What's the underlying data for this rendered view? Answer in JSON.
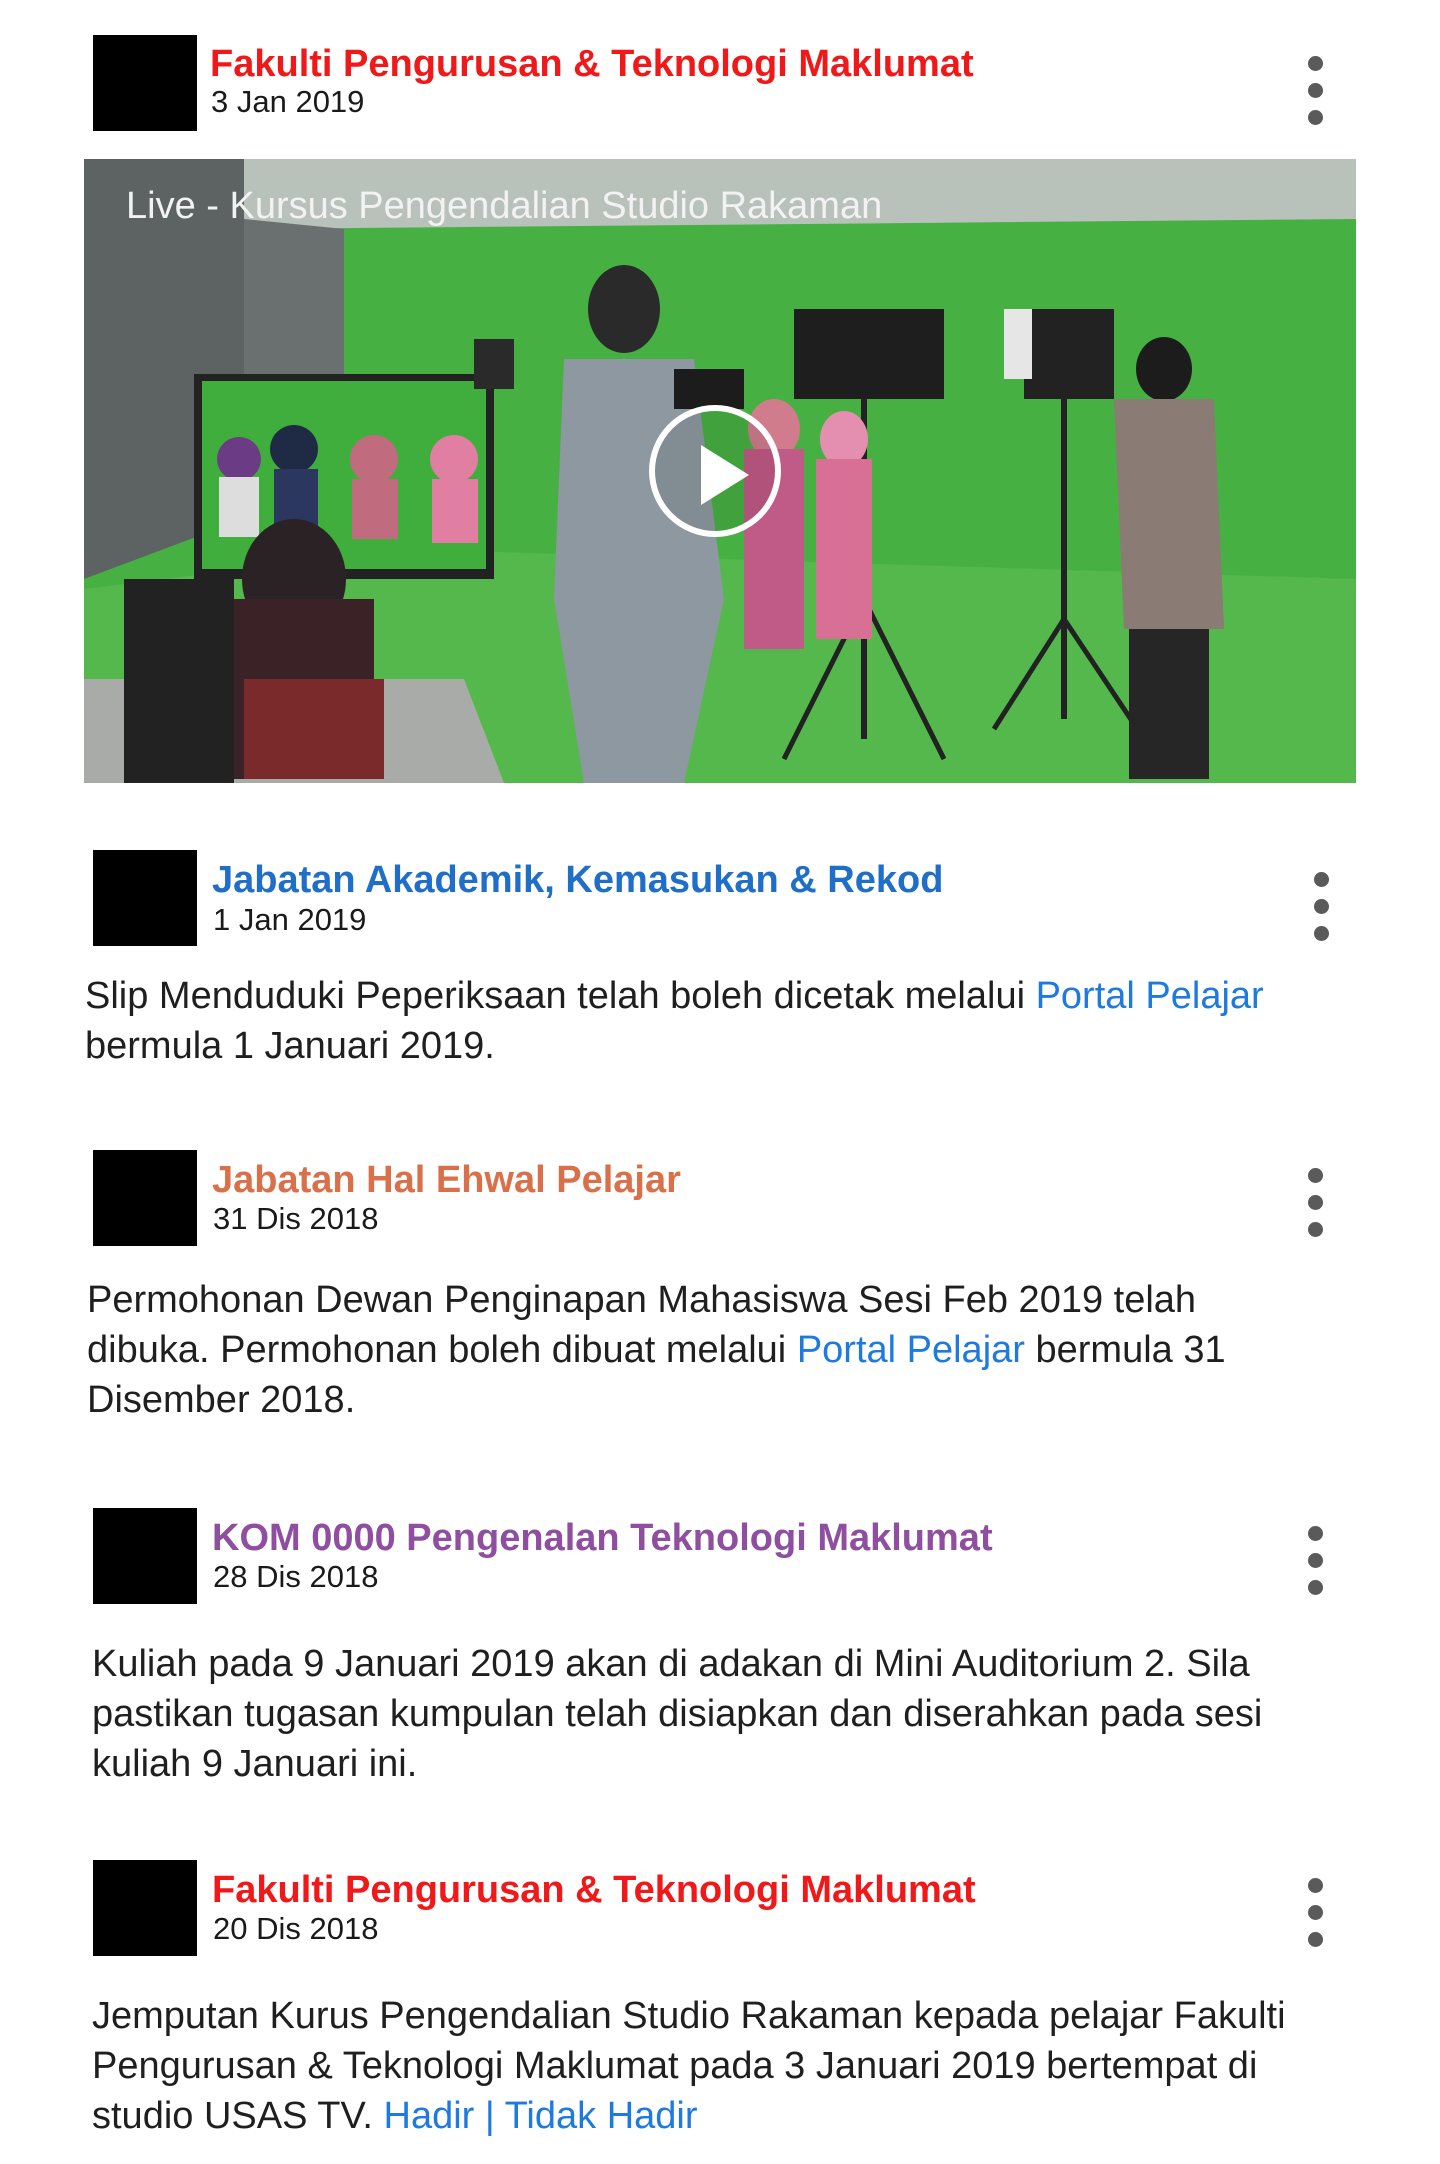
{
  "posts": [
    {
      "author": "Fakulti Pengurusan & Teknologi Maklumat",
      "author_color": "#f01818",
      "date": "3 Jan 2019",
      "video": {
        "title": "Live - Kursus Pengendalian Studio Rakaman",
        "play_icon": "play-icon"
      }
    },
    {
      "author": "Jabatan Akademik, Kemasukan & Rekod",
      "author_color": "#1f6fc9",
      "date": "1 Jan 2019",
      "text_before": "Slip Menduduki Peperiksaan telah boleh dicetak melalui ",
      "link": "Portal Pelajar",
      "text_after": " bermula 1 Januari 2019."
    },
    {
      "author": "Jabatan Hal Ehwal Pelajar",
      "author_color": "#d9704a",
      "date": "31 Dis 2018",
      "text_before": "Permohonan Dewan Penginapan Mahasiswa Sesi Feb 2019 telah dibuka. Permohonan boleh dibuat melalui ",
      "link": "Portal Pelajar",
      "text_after": " bermula 31 Disember 2018."
    },
    {
      "author": "KOM 0000 Pengenalan Teknologi Maklumat",
      "author_color": "#8f4ea0",
      "date": "28 Dis 2018",
      "text": "Kuliah pada 9 Januari 2019 akan di adakan di Mini Auditorium 2. Sila pastikan tugasan kumpulan telah disiapkan dan diserahkan pada sesi kuliah 9 Januari ini."
    },
    {
      "author": "Fakulti Pengurusan & Teknologi Maklumat",
      "author_color": "#f01818",
      "date": "20 Dis 2018",
      "text_before": "Jemputan Kurus Pengendalian Studio Rakaman kepada pelajar Fakulti Pengurusan & Teknologi Maklumat pada 3 Januari 2019 bertempat di studio USAS TV.  ",
      "link_yes": "Hadir",
      "link_sep": " | ",
      "link_no": "Tidak Hadir"
    }
  ],
  "icons": {
    "more": "more-vertical-icon"
  },
  "colors": {
    "link": "#1f7ae0",
    "green_screen": "#3fae3c"
  }
}
